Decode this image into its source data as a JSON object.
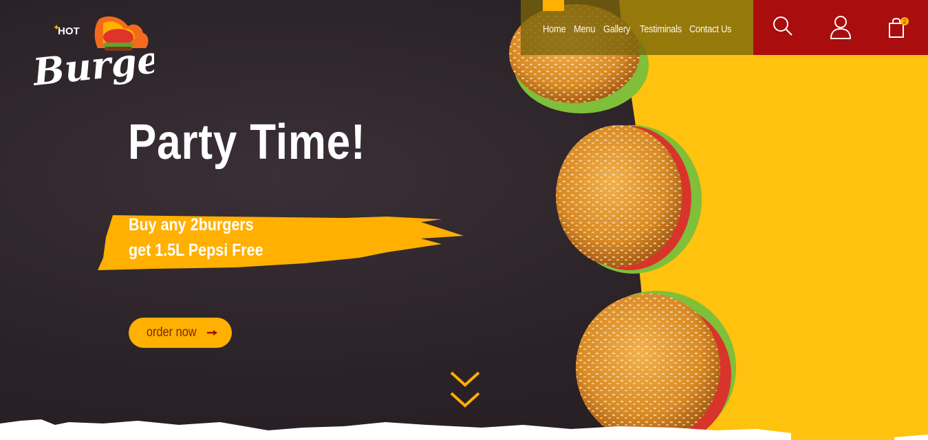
{
  "brand": {
    "logo_small": "HOT",
    "logo_big": "Burgers"
  },
  "nav": {
    "items": [
      {
        "label": "Home"
      },
      {
        "label": "Menu"
      },
      {
        "label": "Gallery"
      },
      {
        "label": "Testiminals"
      },
      {
        "label": "Contact Us"
      }
    ]
  },
  "header_icons": {
    "search": "search-icon",
    "account": "user-icon",
    "cart": "shopping-bag-icon",
    "cart_count": "2"
  },
  "hero": {
    "headline": "Party Time!",
    "promo_line1": "Buy any 2burgers",
    "promo_line2": "get 1.5L Pepsi Free",
    "cta_label": "order now"
  },
  "colors": {
    "accent": "#ffb000",
    "nav_red": "#a90d0d",
    "yellow_bg": "#ffc20e",
    "dark_bg": "#2b2328"
  }
}
